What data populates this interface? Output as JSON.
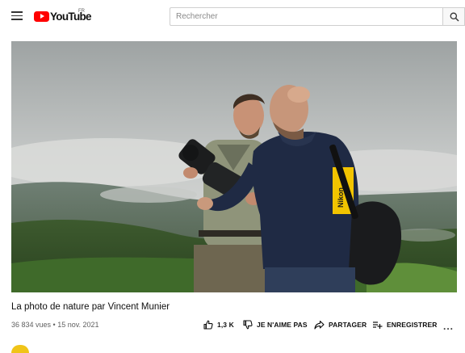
{
  "header": {
    "logo_text": "YouTube",
    "logo_country": "FR",
    "search_placeholder": "Rechercher",
    "icons": [
      "menu-icon",
      "youtube-play-icon",
      "search-icon"
    ]
  },
  "video": {
    "title": "La photo de nature par Vincent Munier",
    "stats": "36 834 vues • 15 nov. 2021",
    "shirt_brand": "Nikon"
  },
  "actions": {
    "like_count": "1,3 K",
    "dislike_label": "JE N'AIME PAS",
    "share_label": "PARTAGER",
    "save_label": "ENREGISTRER",
    "more_label": "..."
  },
  "colors": {
    "brand_red": "#ff0000",
    "text_primary": "#0f0f0f",
    "text_secondary": "#606060",
    "nikon_yellow": "#f2c400"
  }
}
